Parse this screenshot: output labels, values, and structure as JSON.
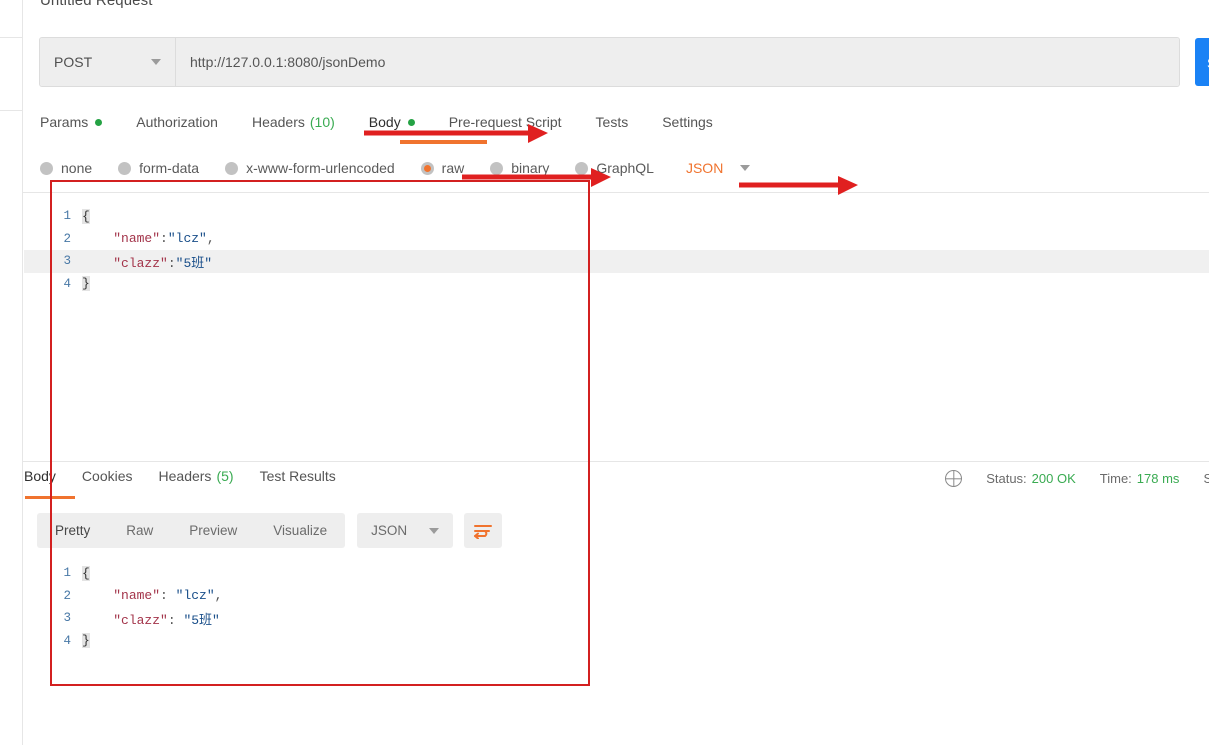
{
  "request": {
    "title": "Untitled Request",
    "method": "POST",
    "method_caret": "chevron-down-icon",
    "url": "http://127.0.0.1:8080/jsonDemo",
    "send_label": "Send",
    "tabs": [
      {
        "label": "Params",
        "marker": "dot",
        "active": false
      },
      {
        "label": "Authorization",
        "marker": "",
        "active": false
      },
      {
        "label": "Headers",
        "marker": "count",
        "count": "(10)",
        "active": false
      },
      {
        "label": "Body",
        "marker": "dot",
        "active": true
      },
      {
        "label": "Pre-request Script",
        "marker": "",
        "active": false
      },
      {
        "label": "Tests",
        "marker": "",
        "active": false
      },
      {
        "label": "Settings",
        "marker": "",
        "active": false
      }
    ],
    "body_types": [
      {
        "label": "none",
        "selected": false
      },
      {
        "label": "form-data",
        "selected": false
      },
      {
        "label": "x-www-form-urlencoded",
        "selected": false
      },
      {
        "label": "raw",
        "selected": true
      },
      {
        "label": "binary",
        "selected": false
      },
      {
        "label": "GraphQL",
        "selected": false
      }
    ],
    "raw_format": "JSON",
    "editor_lines": [
      {
        "num": "1",
        "parts": [
          {
            "t": "{",
            "c": "brace"
          }
        ],
        "highlight": false
      },
      {
        "num": "2",
        "parts": [
          {
            "t": "    ",
            "c": "punc"
          },
          {
            "t": "\"name\"",
            "c": "k"
          },
          {
            "t": ":",
            "c": "punc"
          },
          {
            "t": "\"lcz\"",
            "c": "v"
          },
          {
            "t": ",",
            "c": "punc"
          }
        ],
        "highlight": false
      },
      {
        "num": "3",
        "parts": [
          {
            "t": "    ",
            "c": "punc"
          },
          {
            "t": "\"clazz\"",
            "c": "k"
          },
          {
            "t": ":",
            "c": "punc"
          },
          {
            "t": "\"5班\"",
            "c": "v"
          }
        ],
        "highlight": true
      },
      {
        "num": "4",
        "parts": [
          {
            "t": "}",
            "c": "brace"
          }
        ],
        "highlight": false
      }
    ]
  },
  "response": {
    "tabs": [
      {
        "label": "Body",
        "marker": "",
        "active": true
      },
      {
        "label": "Cookies",
        "marker": "",
        "active": false
      },
      {
        "label": "Headers",
        "marker": "count",
        "count": "(5)",
        "active": false
      },
      {
        "label": "Test Results",
        "marker": "",
        "active": false
      }
    ],
    "status": {
      "globe_icon": "globe-icon",
      "status_label": "Status:",
      "status_value": "200 OK",
      "time_label": "Time:",
      "time_value": "178 ms",
      "size_label": "Si"
    },
    "view_modes": [
      {
        "label": "Pretty",
        "active": true
      },
      {
        "label": "Raw",
        "active": false
      },
      {
        "label": "Preview",
        "active": false
      },
      {
        "label": "Visualize",
        "active": false
      }
    ],
    "content_type": "JSON",
    "wrap_icon": "wrap-text-icon",
    "body_lines": [
      {
        "num": "1",
        "parts": [
          {
            "t": "{",
            "c": "brace"
          }
        ],
        "highlight": false
      },
      {
        "num": "2",
        "parts": [
          {
            "t": "    ",
            "c": "punc"
          },
          {
            "t": "\"name\"",
            "c": "k"
          },
          {
            "t": ": ",
            "c": "punc"
          },
          {
            "t": "\"lcz\"",
            "c": "v"
          },
          {
            "t": ",",
            "c": "punc"
          }
        ],
        "highlight": false
      },
      {
        "num": "3",
        "parts": [
          {
            "t": "    ",
            "c": "punc"
          },
          {
            "t": "\"clazz\"",
            "c": "k"
          },
          {
            "t": ": ",
            "c": "punc"
          },
          {
            "t": "\"5班\"",
            "c": "v"
          }
        ],
        "highlight": false
      },
      {
        "num": "4",
        "parts": [
          {
            "t": "}",
            "c": "brace"
          }
        ],
        "highlight": false
      }
    ]
  },
  "annotations": {
    "box_color": "#d32020",
    "arrow_color": "#e02020",
    "underline_color": "#f0732e"
  }
}
